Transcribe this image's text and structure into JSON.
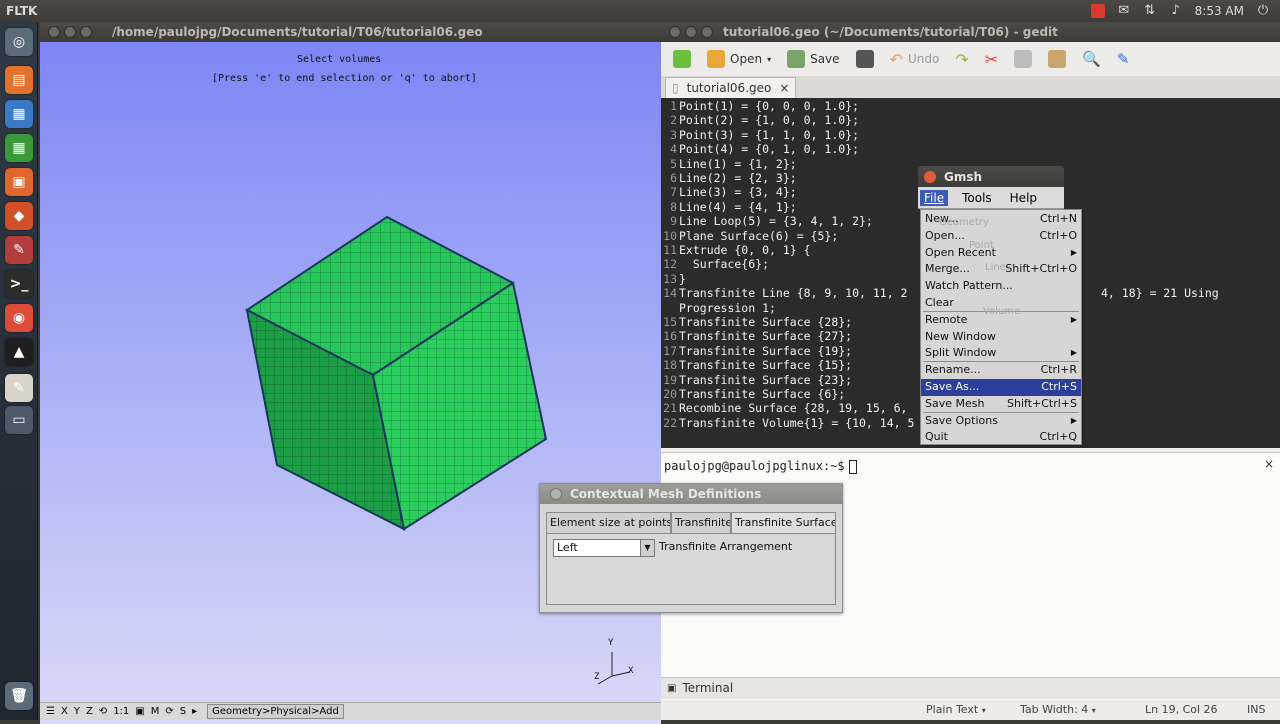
{
  "top_panel": {
    "app_name": "FLTK",
    "clock": "8:53 AM",
    "colors": {
      "panel": "#3c3b37",
      "indicator": "#d83b2e"
    },
    "tray_icons": [
      "gmsh-tray-icon",
      "mail-icon",
      "network-icon",
      "volume-icon",
      "power-icon"
    ]
  },
  "launcher": {
    "items": [
      {
        "name": "dash-icon",
        "glyph": "◎",
        "color": "#5c6b78"
      },
      {
        "name": "files-icon",
        "glyph": "▤",
        "color": "#e2732f"
      },
      {
        "name": "writer-icon",
        "glyph": "▦",
        "color": "#3979c6"
      },
      {
        "name": "calc-icon",
        "glyph": "▦",
        "color": "#3a9a3a"
      },
      {
        "name": "impress-icon",
        "glyph": "▣",
        "color": "#e0662f"
      },
      {
        "name": "software-center-icon",
        "glyph": "◆",
        "color": "#d1502a"
      },
      {
        "name": "settings-icon",
        "glyph": "✎",
        "color": "#b33c3c"
      },
      {
        "name": "terminal-icon",
        "glyph": ">_",
        "color": "#2c2c2c"
      },
      {
        "name": "chrome-icon",
        "glyph": "◉",
        "color": "#dd4b39"
      },
      {
        "name": "gmsh-icon",
        "glyph": "▲",
        "color": "#1e1e1e"
      },
      {
        "name": "gedit-icon",
        "glyph": "✎",
        "color": "#d9d4c7"
      },
      {
        "name": "workspace-icon",
        "glyph": "▭",
        "color": "#4d5966"
      },
      {
        "name": "trash-icon",
        "glyph": "🗑",
        "color": "#5d6b78"
      }
    ]
  },
  "gmsh": {
    "title": "/home/paulojpg/Documents/tutorial/T06/tutorial06.geo",
    "messages": [
      "Select volumes",
      "[Press 'e' to end selection or 'q' to abort]"
    ],
    "axes": {
      "x": "X",
      "y": "Y",
      "z": "Z"
    },
    "status_buttons": [
      "☰",
      "X",
      "Y",
      "Z",
      "⟲",
      "1:1",
      "▣",
      "M",
      "⟳",
      "S",
      "▸"
    ],
    "status_text": "Geometry>Physical>Add",
    "cube_colors": {
      "face": "#27c75a",
      "edge": "#16365a",
      "mesh": "#0b5e2a"
    }
  },
  "gedit": {
    "title": "tutorial06.geo (~/Documents/tutorial/T06) - gedit",
    "toolbar": {
      "open": "Open",
      "save": "Save",
      "undo": "Undo"
    },
    "tab": {
      "label": "tutorial06.geo",
      "close": "×"
    },
    "lines": [
      {
        "n": "1",
        "text": "Point(1) = {0, 0, 0, 1.0};"
      },
      {
        "n": "2",
        "text": "Point(2) = {1, 0, 0, 1.0};"
      },
      {
        "n": "3",
        "text": "Point(3) = {1, 1, 0, 1.0};"
      },
      {
        "n": "4",
        "text": "Point(4) = {0, 1, 0, 1.0};"
      },
      {
        "n": "5",
        "text": "Line(1) = {1, 2};"
      },
      {
        "n": "6",
        "text": "Line(2) = {2, 3};"
      },
      {
        "n": "7",
        "text": "Line(3) = {3, 4};"
      },
      {
        "n": "8",
        "text": "Line(4) = {4, 1};"
      },
      {
        "n": "9",
        "text": "Line Loop(5) = {3, 4, 1, 2};"
      },
      {
        "n": "10",
        "text": "Plane Surface(6) = {5};"
      },
      {
        "n": "11",
        "text": "Extrude {0, 0, 1} {"
      },
      {
        "n": "12",
        "text": "  Surface{6};"
      },
      {
        "n": "13",
        "text": "}"
      },
      {
        "n": "14",
        "text": "Transfinite Line {8, 9, 10, 11, 2"
      },
      {
        "n": "",
        "text": "Progression 1;"
      },
      {
        "n": "15",
        "text": "Transfinite Surface {28};"
      },
      {
        "n": "16",
        "text": "Transfinite Surface {27};"
      },
      {
        "n": "17",
        "text": "Transfinite Surface {19};"
      },
      {
        "n": "18",
        "text": "Transfinite Surface {15};"
      },
      {
        "n": "19",
        "text": "Transfinite Surface {23};"
      },
      {
        "n": "20",
        "text": "Transfinite Surface {6};"
      },
      {
        "n": "21",
        "text": "Recombine Surface {28, 19, 15, 6,"
      },
      {
        "n": "22",
        "text": "Transfinite Volume{1} = {10, 14, 5"
      }
    ],
    "line14_tail": "4, 18} = 21 Using",
    "terminal": {
      "prompt": "paulojpg@paulojpglinux:~$",
      "close": "×"
    },
    "bottom_tab": "Terminal",
    "status": {
      "syntax": "Plain Text",
      "tab_width": "Tab Width:  4",
      "position": "Ln 19, Col 26",
      "mode": "INS"
    },
    "colors": {
      "editor_bg": "#2b2b2b",
      "editor_fg": "#f2f2f2"
    }
  },
  "gmsh_menu": {
    "title": "Gmsh",
    "menubar": [
      "File",
      "Tools",
      "Help"
    ],
    "items": [
      {
        "label": "New...",
        "accel": "Ctrl+N",
        "sub": false
      },
      {
        "label": "Open...",
        "accel": "Ctrl+O",
        "sub": false
      },
      {
        "label": "Open Recent",
        "accel": "",
        "sub": true
      },
      {
        "label": "Merge...",
        "accel": "Shift+Ctrl+O",
        "sub": false
      },
      {
        "label": "Watch Pattern...",
        "accel": "",
        "sub": false
      },
      {
        "label": "Clear",
        "accel": "",
        "sub": false
      },
      {
        "label": "Remote",
        "accel": "",
        "sub": true
      },
      {
        "label": "New Window",
        "accel": "",
        "sub": false
      },
      {
        "label": "Split Window",
        "accel": "",
        "sub": true
      },
      {
        "label": "Rename...",
        "accel": "Ctrl+R",
        "sub": false
      },
      {
        "label": "Save As...",
        "accel": "Ctrl+S",
        "sub": false,
        "selected": true
      },
      {
        "label": "Save Mesh",
        "accel": "Shift+Ctrl+S",
        "sub": false
      },
      {
        "label": "Save Options",
        "accel": "",
        "sub": true
      },
      {
        "label": "Quit",
        "accel": "Ctrl+Q",
        "sub": false
      }
    ],
    "ghost_labels": [
      "Geometry",
      "Point",
      "Line",
      "Volume"
    ],
    "colors": {
      "selected": "#2d3f9a"
    }
  },
  "ctx_dialog": {
    "title": "Contextual Mesh Definitions",
    "tabs": [
      "Element size at points",
      "Transfinite",
      "Transfinite Surface"
    ],
    "select_value": "Left",
    "field_label": "Transfinite Arrangement"
  }
}
